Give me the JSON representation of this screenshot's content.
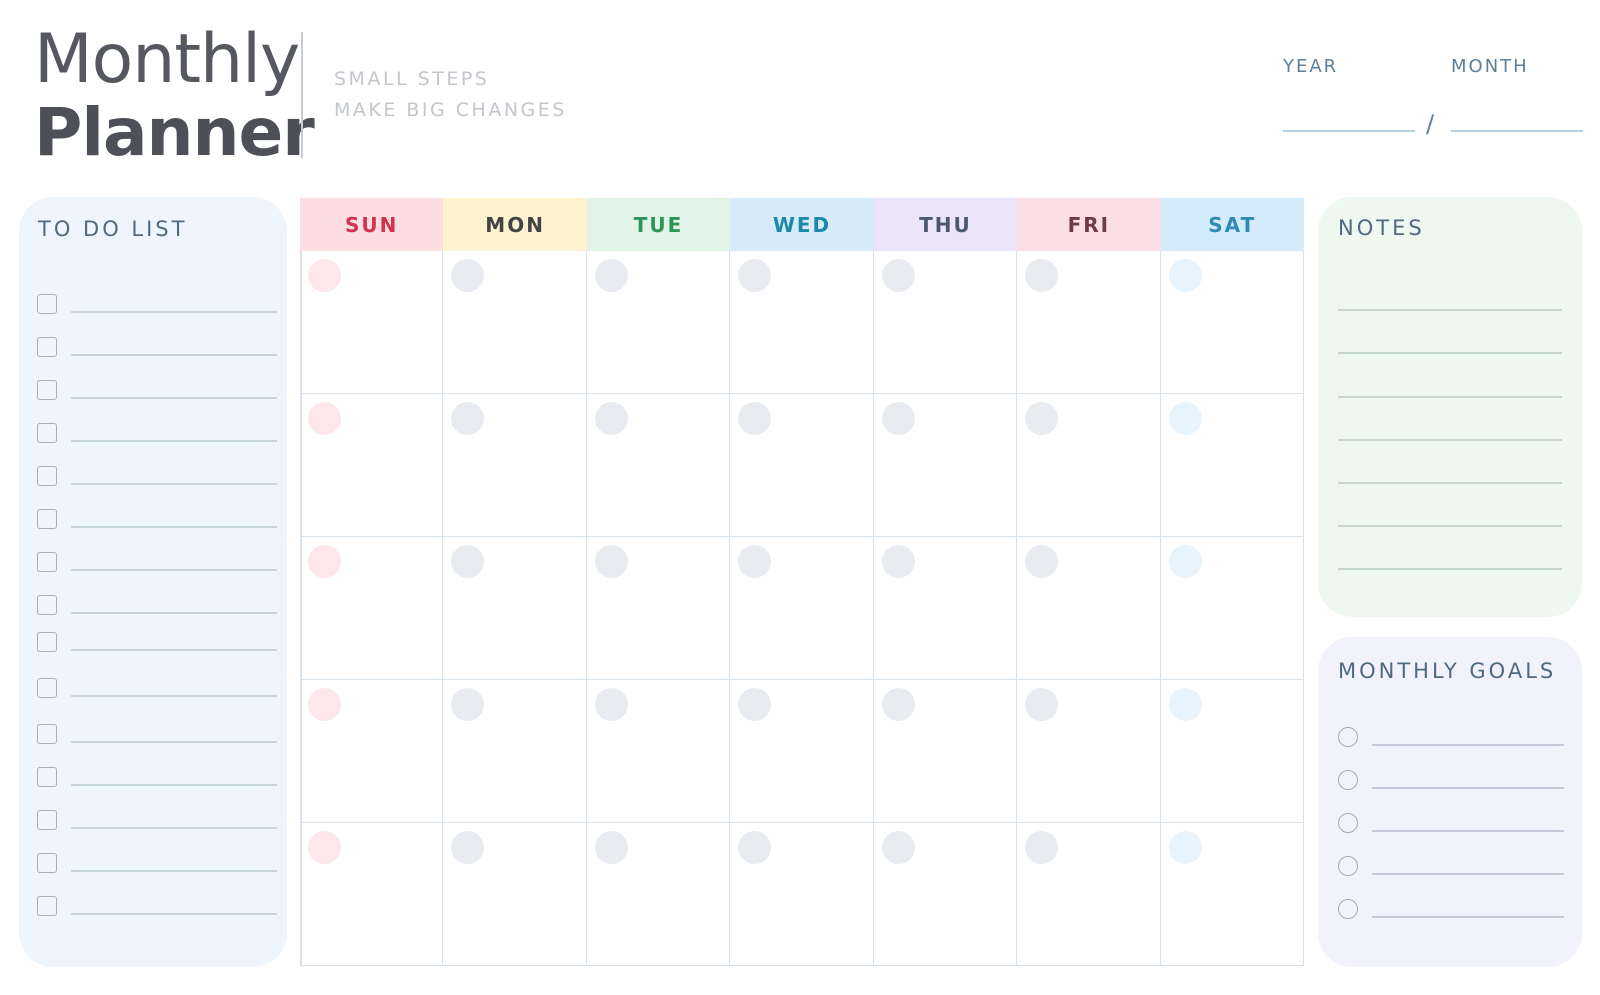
{
  "header": {
    "title_line1": "Monthly",
    "title_line2": "Planner",
    "tagline_line1": "SMALL STEPS",
    "tagline_line2": "MAKE BIG CHANGES",
    "year_label": "YEAR",
    "month_label": "MONTH",
    "separator": "/"
  },
  "todo": {
    "title": "TO DO LIST",
    "item_count": 15
  },
  "notes": {
    "title": "NOTES",
    "line_count": 7
  },
  "goals": {
    "title": "MONTHLY GOALS",
    "item_count": 5
  },
  "calendar": {
    "weeks": 5,
    "days": [
      {
        "label": "SUN",
        "text_color": "#d0344f",
        "bg": "#fcdde2",
        "dot": "#fde7ea"
      },
      {
        "label": "MON",
        "text_color": "#444444",
        "bg": "#fdf3d0",
        "dot": "#e8ebf0"
      },
      {
        "label": "TUE",
        "text_color": "#2b9655",
        "bg": "#e2f4e7",
        "dot": "#e8ebf0"
      },
      {
        "label": "WED",
        "text_color": "#1a8aa8",
        "bg": "#d7ebfa",
        "dot": "#e8ebf0"
      },
      {
        "label": "THU",
        "text_color": "#4c5870",
        "bg": "#ece4f8",
        "dot": "#e8ebf0"
      },
      {
        "label": "FRI",
        "text_color": "#6e3b48",
        "bg": "#fbdfe4",
        "dot": "#e8ebf0"
      },
      {
        "label": "SAT",
        "text_color": "#2f8ab4",
        "bg": "#d3ebfa",
        "dot": "#e8f4fd"
      }
    ]
  }
}
